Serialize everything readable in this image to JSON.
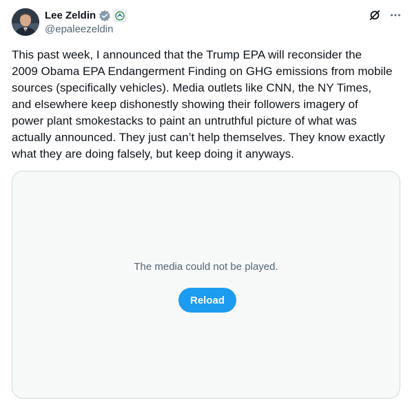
{
  "author": {
    "name": "Lee Zeldin",
    "handle": "@epaleezeldin",
    "verified_icon": "verified-badge-icon",
    "affiliation_icon": "epa-logo-icon",
    "avatar": "profile-photo"
  },
  "actions": {
    "grok_icon": "grok-icon",
    "more_icon": "more-icon",
    "more_label": "···"
  },
  "post": {
    "text": "This past week, I announced that the Trump EPA will reconsider the\n2009 Obama EPA Endangerment Finding on GHG emissions from mobile\nsources (specifically vehicles). Media outlets like CNN, the NY Times,\nand elsewhere keep dishonestly showing their followers imagery of\npower plant smokestacks to paint an untruthful picture of what was\nactually announced. They just can’t help themselves. They know exactly\nwhat they are doing falsely, but keep doing it anyways."
  },
  "media": {
    "error_message": "The media could not be played.",
    "reload_label": "Reload"
  },
  "colors": {
    "accent": "#1d9bf0",
    "text": "#0f1419",
    "secondary_text": "#536471",
    "media_bg": "#f7f9f9",
    "border": "#cfd9de"
  }
}
